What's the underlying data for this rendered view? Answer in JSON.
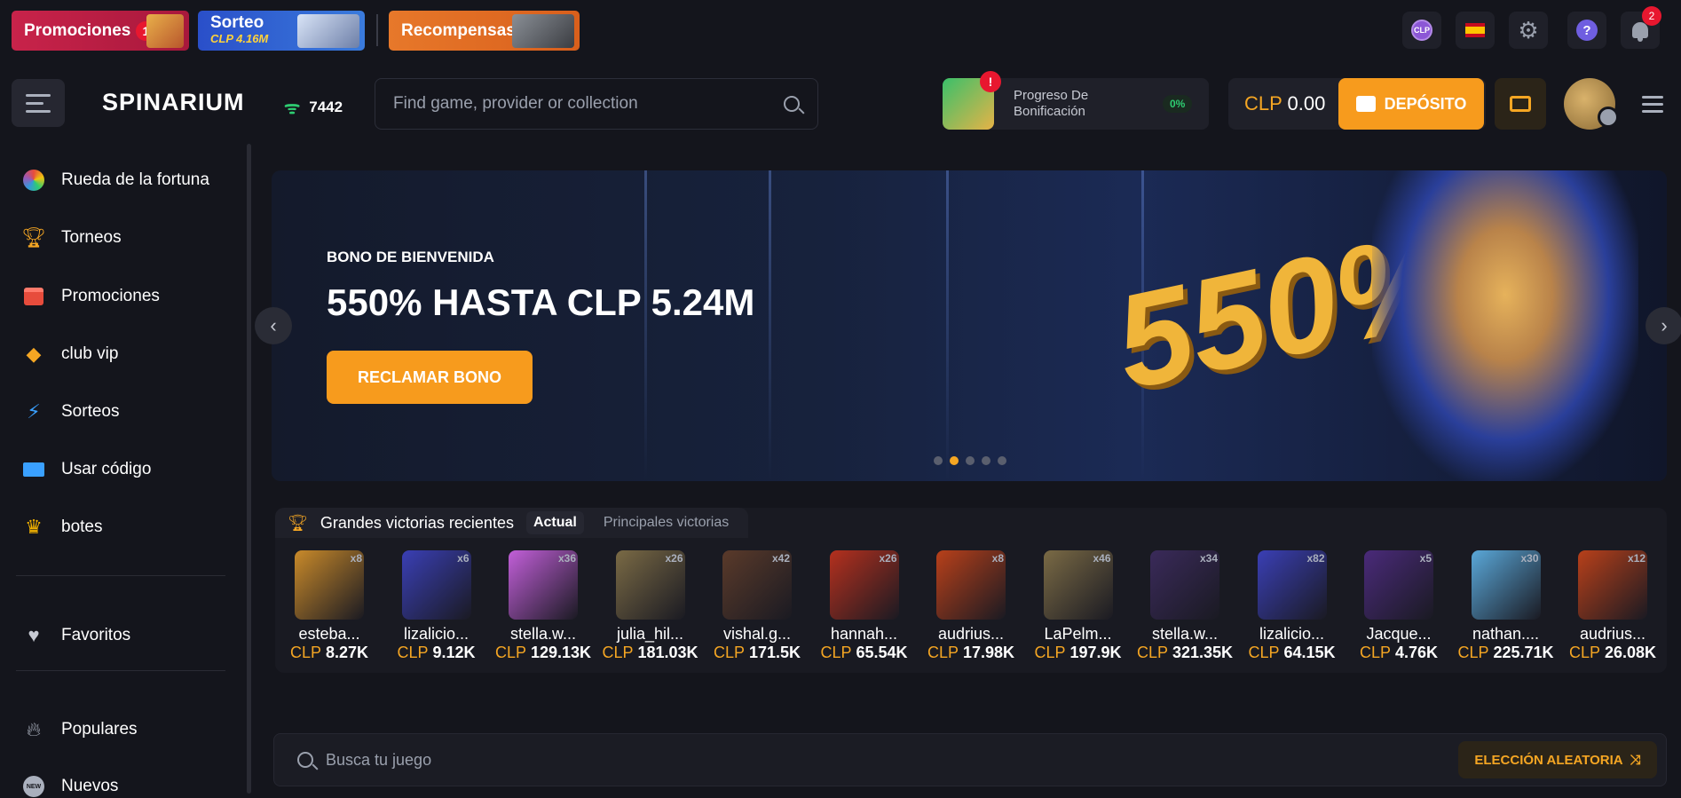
{
  "topbar": {
    "promotions": {
      "label": "Promociones",
      "badge": "1"
    },
    "raffle": {
      "label": "Sorteo",
      "sub": "CLP 4.16M"
    },
    "rewards": {
      "label": "Recompensas"
    },
    "currency_chip": "CLP",
    "notifications_count": "2"
  },
  "header": {
    "logo": "SPINARIUM",
    "online_count": "7442",
    "search_placeholder": "Find game, provider or collection",
    "bonus_progress": {
      "label": "Progreso De Bonificación",
      "percent": "0%",
      "alert": "!"
    },
    "balance": {
      "currency": "CLP",
      "amount": "0.00"
    },
    "deposit_label": "DEPÓSITO"
  },
  "sidebar": {
    "items": [
      {
        "label": "Rueda de la fortuna",
        "icon": "wheel-icon"
      },
      {
        "label": "Torneos",
        "icon": "trophy-icon"
      },
      {
        "label": "Promociones",
        "icon": "gift-icon"
      },
      {
        "label": "club vip",
        "icon": "diamond-icon"
      },
      {
        "label": "Sorteos",
        "icon": "lightning-icon"
      },
      {
        "label": "Usar código",
        "icon": "ticket-icon"
      },
      {
        "label": "botes",
        "icon": "crown-icon"
      }
    ],
    "favorites": {
      "label": "Favoritos",
      "icon": "heart-icon"
    },
    "popular": {
      "label": "Populares",
      "icon": "flame-icon"
    },
    "new": {
      "label": "Nuevos",
      "icon": "new-icon"
    }
  },
  "hero": {
    "kicker": "BONO DE BIENVENIDA",
    "headline": "550% HASTA CLP 5.24M",
    "cta": "RECLAMAR BONO",
    "art_text": "550%",
    "active_slide": 2,
    "slide_count": 5
  },
  "wins": {
    "title": "Grandes victorias recientes",
    "tabs": [
      "Actual",
      "Principales victorias"
    ],
    "items": [
      {
        "user": "esteba...",
        "currency": "CLP",
        "amount": "8.27K",
        "mult": "x8",
        "color": "#c98a2a"
      },
      {
        "user": "lizalicio...",
        "currency": "CLP",
        "amount": "9.12K",
        "mult": "x6",
        "color": "#3a3fb5"
      },
      {
        "user": "stella.w...",
        "currency": "CLP",
        "amount": "129.13K",
        "mult": "x36",
        "color": "#c25fd9"
      },
      {
        "user": "julia_hil...",
        "currency": "CLP",
        "amount": "181.03K",
        "mult": "x26",
        "color": "#7a6a45"
      },
      {
        "user": "vishal.g...",
        "currency": "CLP",
        "amount": "171.5K",
        "mult": "x42",
        "color": "#5a3a2a"
      },
      {
        "user": "hannah...",
        "currency": "CLP",
        "amount": "65.54K",
        "mult": "x26",
        "color": "#b5301e"
      },
      {
        "user": "audrius...",
        "currency": "CLP",
        "amount": "17.98K",
        "mult": "x8",
        "color": "#b8401a"
      },
      {
        "user": "LaPelm...",
        "currency": "CLP",
        "amount": "197.9K",
        "mult": "x46",
        "color": "#7a6a45"
      },
      {
        "user": "stella.w...",
        "currency": "CLP",
        "amount": "321.35K",
        "mult": "x34",
        "color": "#3a2a5a"
      },
      {
        "user": "lizalicio...",
        "currency": "CLP",
        "amount": "64.15K",
        "mult": "x82",
        "color": "#3a3fb5"
      },
      {
        "user": "Jacque...",
        "currency": "CLP",
        "amount": "4.76K",
        "mult": "x5",
        "color": "#4a2a7a"
      },
      {
        "user": "nathan....",
        "currency": "CLP",
        "amount": "225.71K",
        "mult": "x30",
        "color": "#5aa8d9"
      },
      {
        "user": "audrius...",
        "currency": "CLP",
        "amount": "26.08K",
        "mult": "x12",
        "color": "#b8401a"
      }
    ]
  },
  "game_search": {
    "placeholder": "Busca tu juego",
    "random_label": "ELECCIÓN ALEATORIA"
  }
}
